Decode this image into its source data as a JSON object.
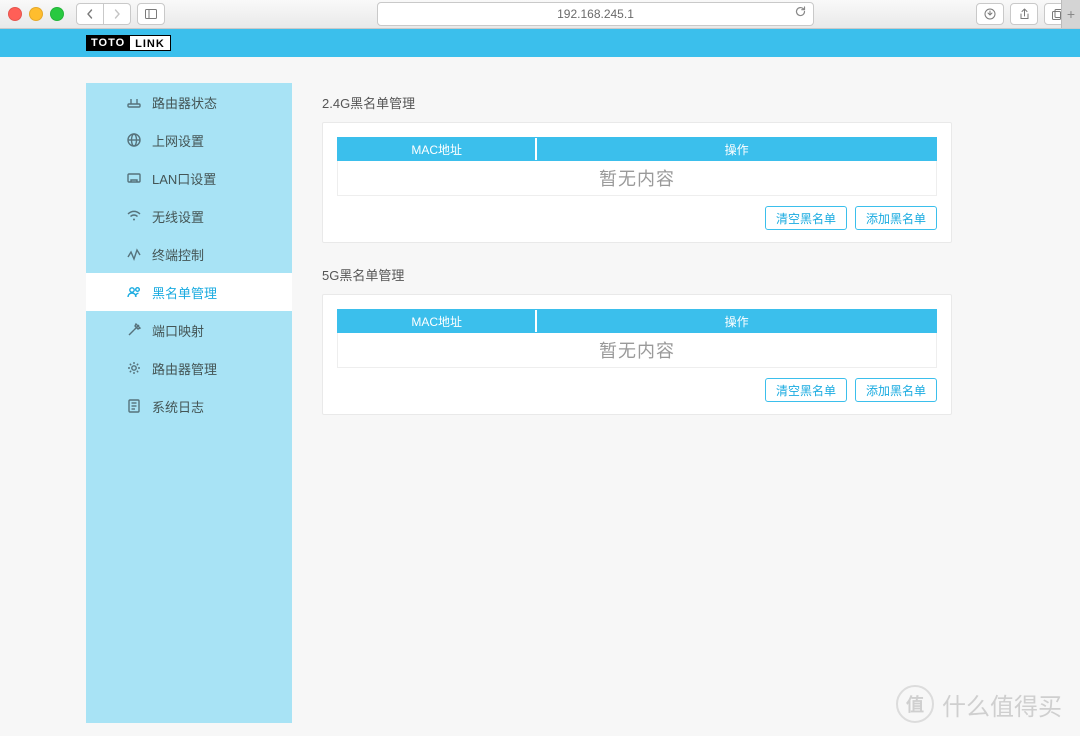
{
  "browser": {
    "url": "192.168.245.1"
  },
  "logo": {
    "left": "TOTO",
    "right": "LINK"
  },
  "sidebar": {
    "items": [
      {
        "id": "status",
        "label": "路由器状态"
      },
      {
        "id": "wan",
        "label": "上网设置"
      },
      {
        "id": "lan",
        "label": "LAN口设置"
      },
      {
        "id": "wifi",
        "label": "无线设置"
      },
      {
        "id": "client",
        "label": "终端控制"
      },
      {
        "id": "blacklist",
        "label": "黑名单管理",
        "active": true
      },
      {
        "id": "portmap",
        "label": "端口映射"
      },
      {
        "id": "admin",
        "label": "路由器管理"
      },
      {
        "id": "syslog",
        "label": "系统日志"
      }
    ]
  },
  "sections": [
    {
      "title": "2.4G黑名单管理",
      "columns": {
        "mac": "MAC地址",
        "op": "操作"
      },
      "empty": "暂无内容",
      "buttons": {
        "clear": "清空黑名单",
        "add": "添加黑名单"
      }
    },
    {
      "title": "5G黑名单管理",
      "columns": {
        "mac": "MAC地址",
        "op": "操作"
      },
      "empty": "暂无内容",
      "buttons": {
        "clear": "清空黑名单",
        "add": "添加黑名单"
      }
    }
  ],
  "watermark": {
    "badge": "值",
    "text": "什么值得买"
  }
}
